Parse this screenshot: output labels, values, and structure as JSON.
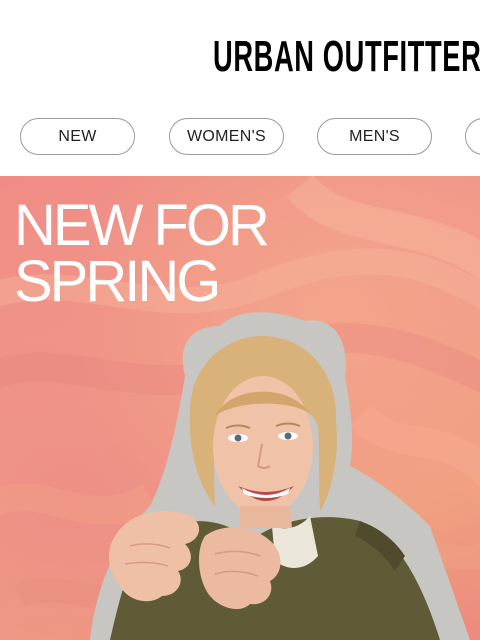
{
  "header": {
    "brand": "URBAN OUTFITTERS"
  },
  "nav": {
    "pills": [
      {
        "label": "NEW"
      },
      {
        "label": "WOMEN'S"
      },
      {
        "label": "MEN'S"
      },
      {
        "label": ""
      }
    ]
  },
  "hero": {
    "headline_line1": "NEW FOR",
    "headline_line2": "SPRING",
    "background_color": "#ef8f85",
    "text_color": "#ffffff"
  }
}
